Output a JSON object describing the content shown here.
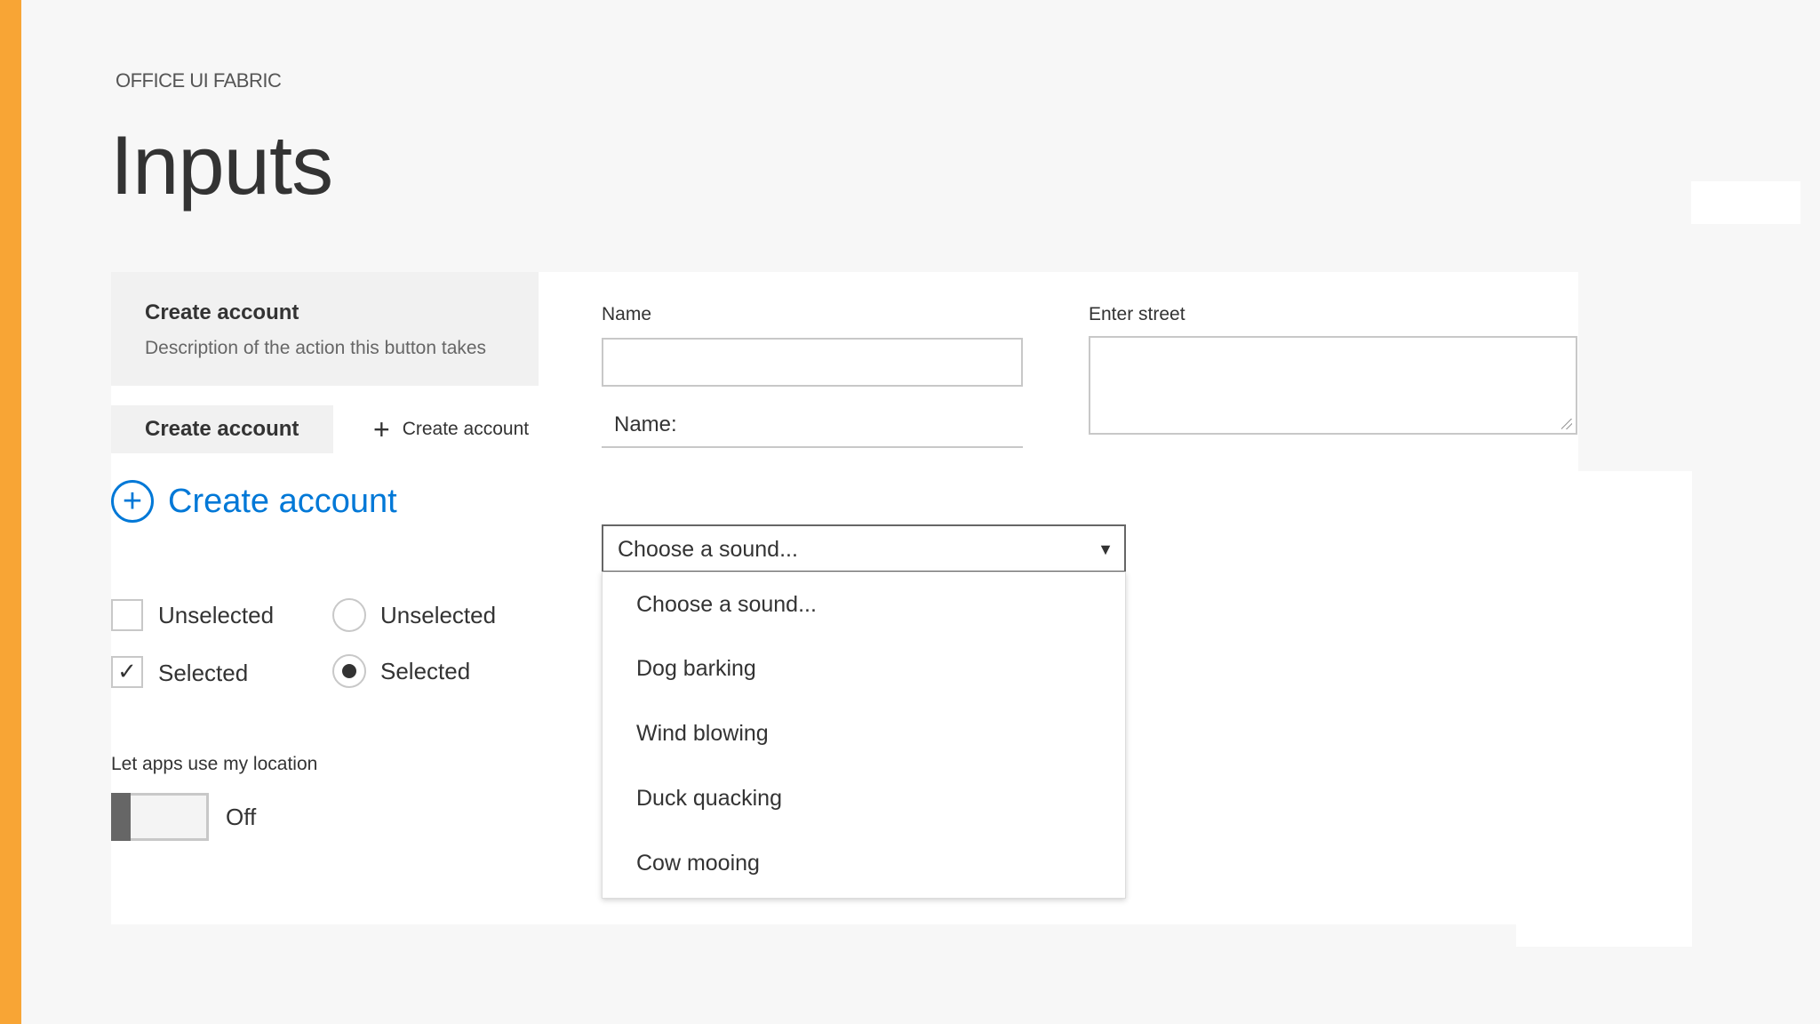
{
  "header": {
    "eyebrow": "OFFICE UI FABRIC",
    "title": "Inputs"
  },
  "buttons": {
    "compound": {
      "title": "Create account",
      "description": "Description of the action this button takes"
    },
    "default_label": "Create account",
    "command_label": "Create account",
    "hero_label": "Create account"
  },
  "fields": {
    "name_label": "Name",
    "name_value": "",
    "name_underlined_label": "Name:",
    "street_label": "Enter street",
    "street_value": ""
  },
  "dropdown": {
    "selected": "Choose a sound...",
    "options": [
      "Choose a sound...",
      "Dog barking",
      "Wind blowing",
      "Duck quacking",
      "Cow mooing"
    ]
  },
  "choices": {
    "checkbox_unselected": "Unselected",
    "checkbox_selected": "Selected",
    "radio_unselected": "Unselected",
    "radio_selected": "Selected"
  },
  "toggle": {
    "label": "Let apps use my location",
    "state": "Off",
    "on": false
  },
  "colors": {
    "accent": "#f8a535",
    "link": "#0078d7"
  },
  "icons": {
    "add": "plus-icon",
    "add_circle": "plus-circle-icon",
    "dropdown": "chevron-down-icon",
    "check": "check-icon"
  }
}
